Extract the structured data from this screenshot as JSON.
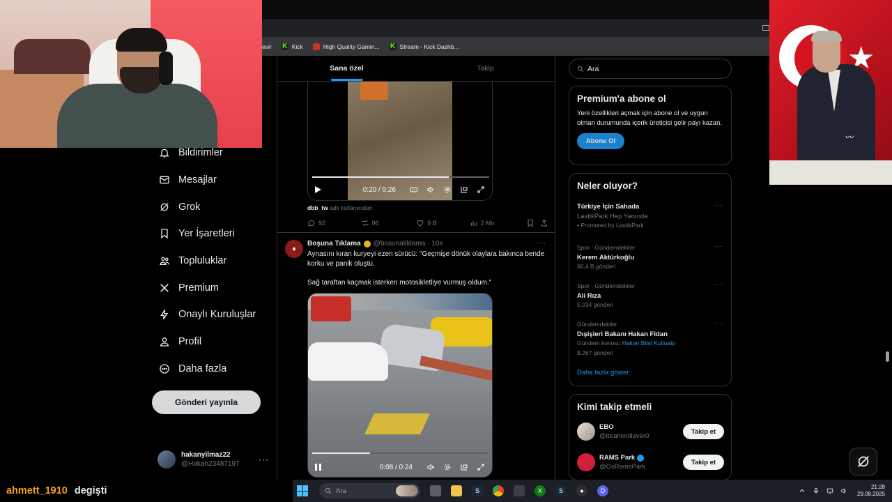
{
  "browser": {
    "bookmarks": [
      {
        "label": "evir"
      },
      {
        "label": "Kick"
      },
      {
        "label": "High Quality Gamin..."
      },
      {
        "label": "Stream - Kick Dashb..."
      }
    ]
  },
  "feed": {
    "tabs": [
      {
        "label": "Sana özel",
        "active": true
      },
      {
        "label": "Takip",
        "active": false
      }
    ],
    "video1": {
      "time": "0:20 / 0:26",
      "progress": 0.77
    },
    "tweet1": {
      "source_user": "dbb_tw",
      "source_suffix": " adlı kullanıcıdan",
      "replies": "92",
      "reposts": "96",
      "likes": "9 B",
      "views": "2 Mn"
    },
    "tweet2": {
      "name": "Boşuna Tıklama",
      "handle": "@bosunatiklama · 10s",
      "text": "Aynasını kıran kuryeyi ezen sürücü: \"Geçmişe dönük olaylara bakınca bende korku ve panik oluştu.\n\nSağ taraftan kaçmak isterken motosikletliye vurmuş oldum.\"",
      "video_time": "0:08 / 0:24",
      "video_progress": 0.33
    }
  },
  "nav": {
    "items": [
      {
        "label": "Bildirimler",
        "icon": "bell-icon"
      },
      {
        "label": "Mesajlar",
        "icon": "mail-icon"
      },
      {
        "label": "Grok",
        "icon": "grok-icon"
      },
      {
        "label": "Yer İşaretleri",
        "icon": "bookmark-icon"
      },
      {
        "label": "Topluluklar",
        "icon": "communities-icon"
      },
      {
        "label": "Premium",
        "icon": "x-logo-icon"
      },
      {
        "label": "Onaylı Kuruluşlar",
        "icon": "lightning-icon"
      },
      {
        "label": "Profil",
        "icon": "person-icon"
      },
      {
        "label": "Daha fazla",
        "icon": "more-circle-icon"
      }
    ],
    "post_button": "Gönderi yayınla",
    "account": {
      "name": "hakanyilmaz22",
      "handle": "@Hakan23487197"
    }
  },
  "sidebar": {
    "search_placeholder": "Ara",
    "premium": {
      "title": "Premium'a abone ol",
      "desc": "Yeni özellikleri açmak için abone ol ve uygun olman durumunda içerik üreticisi gelir payı kazan.",
      "button": "Abone Ol"
    },
    "trends": {
      "title": "Neler oluyor?",
      "items": [
        {
          "name": "Türkiye İçin Sahada",
          "line2": "LastikPark Hep Yanında",
          "line3": "Promoted by LastikPark"
        },
        {
          "category": "Spor · Gündemdekiler",
          "name": "Kerem Aktürkoğlu",
          "count": "66,4 B gönderi"
        },
        {
          "category": "Spor · Gündemdekiler",
          "name": "Ali Rıza",
          "count": "5.034 gönderi"
        },
        {
          "category": "Gündemdekiler",
          "name": "Dışişleri Bakanı Hakan Fidan",
          "topic_prefix": "Gündem konusu ",
          "topic_link": "Hakan Bilal Kutlualp",
          "count": "8.267 gönderi"
        }
      ],
      "show_more": "Daha fazla göster"
    },
    "who_to_follow": {
      "title": "Kimi takip etmeli",
      "items": [
        {
          "name": "EBO",
          "handle": "@ibrahimtilaver0",
          "button": "Takip et"
        },
        {
          "name": "RAMS Park",
          "handle": "@GsRamsPark",
          "button": "Takip et"
        }
      ]
    }
  },
  "chat": {
    "user": "ahmett_1910",
    "message": "degişti"
  },
  "taskbar": {
    "search_placeholder": "Ara",
    "time": "21:28",
    "date": "29.08.2025"
  },
  "colors": {
    "accent": "#1d9bf0",
    "chat_user": "#f0a31a",
    "kick_green": "#53fc18"
  }
}
